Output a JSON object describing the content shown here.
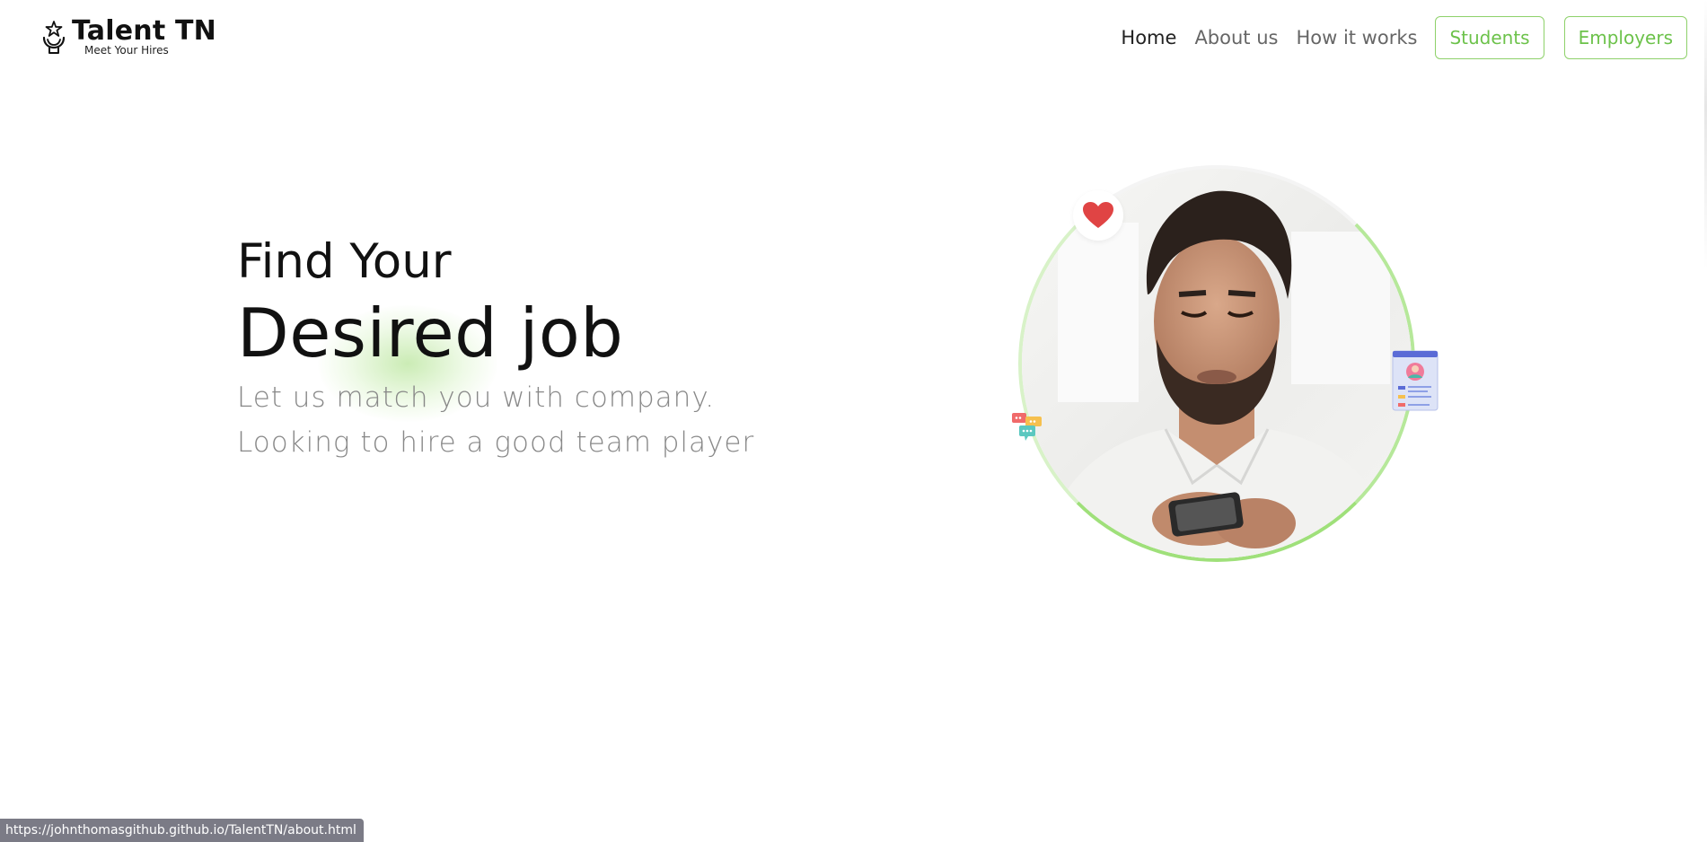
{
  "header": {
    "logo_title": "Talent TN",
    "logo_tagline": "Meet Your Hires"
  },
  "nav": {
    "links": [
      {
        "label": "Home",
        "active": true
      },
      {
        "label": "About us",
        "active": false
      },
      {
        "label": "How it works",
        "active": false
      }
    ],
    "buttons": [
      {
        "label": "Students"
      },
      {
        "label": "Employers"
      }
    ]
  },
  "hero": {
    "line1": "Find Your",
    "line2": "Desired job",
    "sub1": "Let us match you with company.",
    "sub2": "Looking to hire a good team player"
  },
  "illustrations": {
    "photo": "man-looking-at-phone",
    "badges": [
      "heart-icon",
      "chat-bubbles-icon",
      "profile-card-icon"
    ]
  },
  "status_bar": {
    "url": "https://johnthomasgithub.github.io/TalentTN/about.html"
  },
  "colors": {
    "accent": "#6cc24a",
    "accent_border": "#8ed16a",
    "heart": "#e04444",
    "status_bar_bg": "#7b7b86"
  }
}
